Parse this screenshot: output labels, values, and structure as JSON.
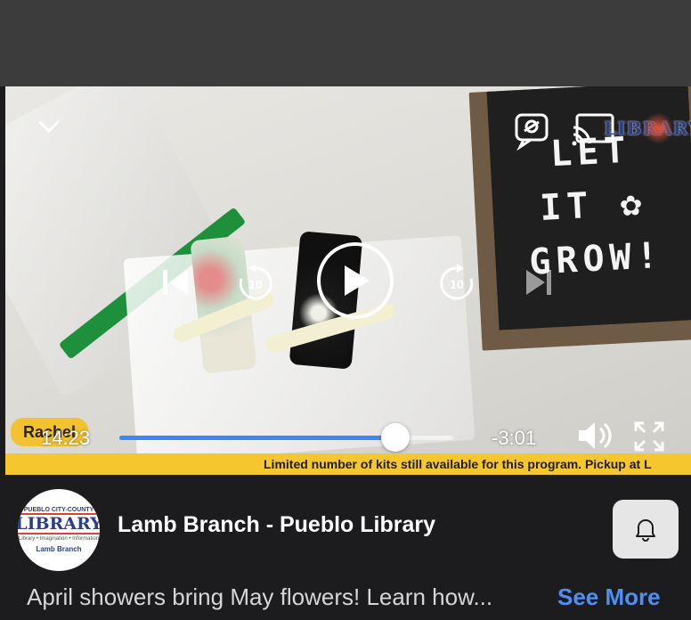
{
  "video": {
    "board_lines": [
      "LET",
      "IT ✿",
      "GROW!"
    ],
    "logo_text": "LIBRARY",
    "elapsed": "14:23",
    "remaining": "-3:01",
    "name_tag": "Rachel",
    "progress_fraction": 0.826,
    "ticker": "Limited number of kits still available for this program. Pickup at L"
  },
  "page": {
    "name": "Lamb Branch - Pueblo Library",
    "avatar": {
      "top": "PUEBLO CITY-COUNTY",
      "main": "LIBRARY",
      "sub": "Library • Imagination • Information",
      "branch": "Lamb Branch"
    },
    "description": "April showers bring May flowers! Learn how...",
    "see_more": "See More"
  },
  "colors": {
    "accent": "#3e86f5",
    "ticker": "#f5c62e",
    "link": "#4d8ff5"
  }
}
